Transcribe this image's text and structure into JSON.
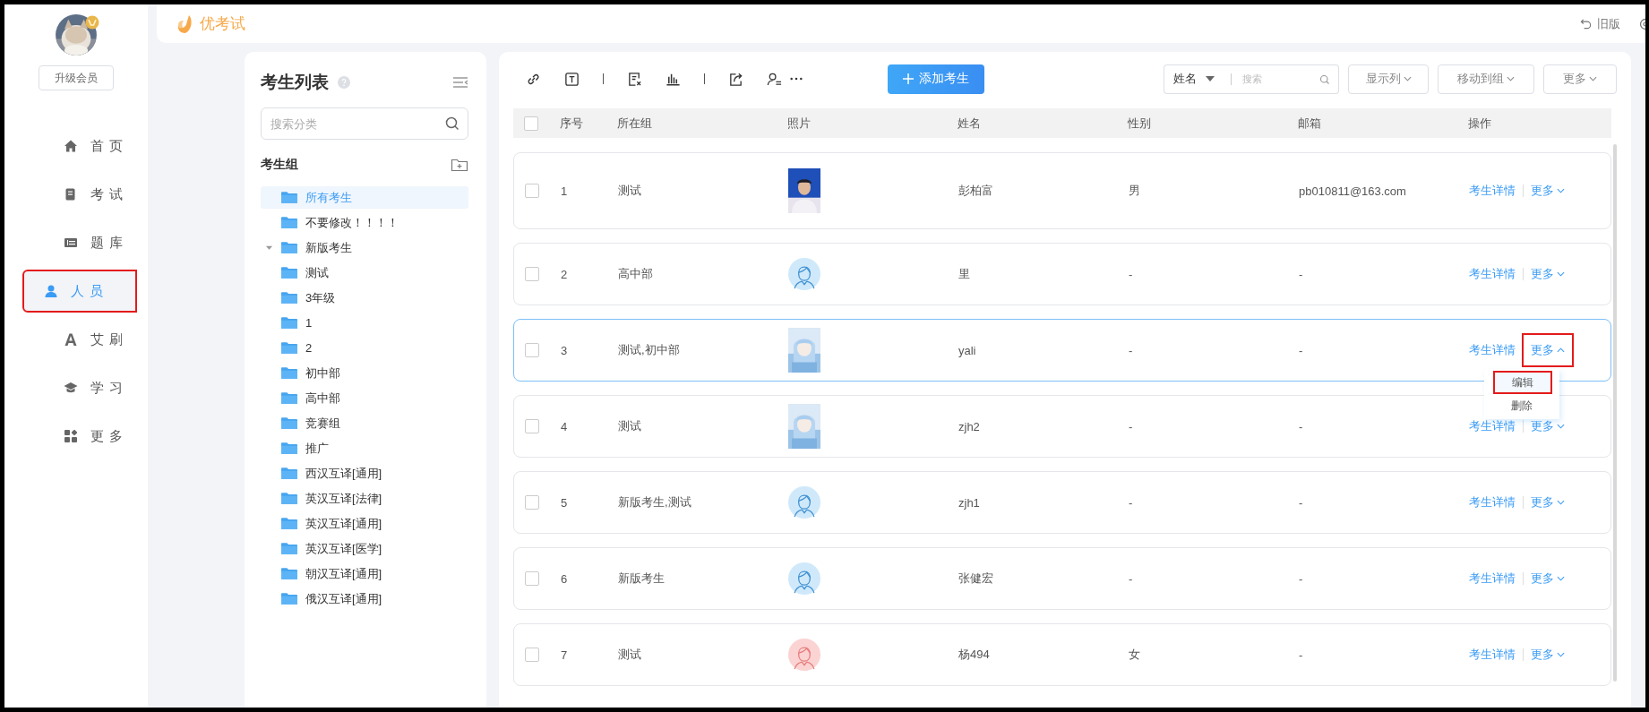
{
  "sidebar": {
    "avatar": {
      "kind": "picture"
    },
    "upgrade_button": "升级会员",
    "items": [
      {
        "kind": "home",
        "label": "首页",
        "selected": false,
        "annotated": false
      },
      {
        "kind": "exam",
        "label": "考试",
        "selected": false,
        "annotated": false
      },
      {
        "kind": "bank",
        "label": "题库",
        "selected": false,
        "annotated": false
      },
      {
        "kind": "people",
        "label": "人员",
        "selected": true,
        "annotated": true
      },
      {
        "kind": "print",
        "label": "艾刷",
        "selected": false,
        "annotated": false
      },
      {
        "kind": "study",
        "label": "学习",
        "selected": false,
        "annotated": false
      },
      {
        "kind": "more",
        "label": "更多",
        "selected": false,
        "annotated": false
      }
    ]
  },
  "header": {
    "logo": "优考试",
    "old_version": "旧版"
  },
  "groups": {
    "title": "考生列表",
    "search": {
      "placeholder": "搜索分类"
    },
    "section": "考生组",
    "items": [
      {
        "label": "所有考生",
        "selected": true
      },
      {
        "label": "不要修改！！！！",
        "selected": false
      },
      {
        "label": "新版考生",
        "selected": false,
        "expanded": true
      },
      {
        "label": "测试",
        "selected": false
      },
      {
        "label": "3年级",
        "selected": false
      },
      {
        "label": "1",
        "selected": false
      },
      {
        "label": "2",
        "selected": false
      },
      {
        "label": "初中部",
        "selected": false
      },
      {
        "label": "高中部",
        "selected": false
      },
      {
        "label": "竞赛组",
        "selected": false
      },
      {
        "label": "推广",
        "selected": false
      },
      {
        "label": "西汉互译[通用]",
        "selected": false
      },
      {
        "label": "英汉互译[法律]",
        "selected": false
      },
      {
        "label": "英汉互译[通用]",
        "selected": false
      },
      {
        "label": "英汉互译[医学]",
        "selected": false
      },
      {
        "label": "朝汉互译[通用]",
        "selected": false
      },
      {
        "label": "俄汉互译[通用]",
        "selected": false
      }
    ]
  },
  "toolbar": {
    "add_button": "添加考生",
    "search_field": {
      "field": "姓名",
      "placeholder": "搜索"
    },
    "buttons": [
      "显示列",
      "移动到组",
      "更多"
    ]
  },
  "table": {
    "all_checked": false,
    "columns": [
      "序号",
      "所在组",
      "照片",
      "姓名",
      "性别",
      "邮箱",
      "操作"
    ],
    "rows": [
      {
        "index": "1",
        "group": "测试",
        "photo": {
          "kind": "picture"
        },
        "name": "彭柏富",
        "gender": "男",
        "email": "pb010811@163.com",
        "detail": "考生详情",
        "more": "更多",
        "checked": false,
        "selected": false,
        "menu_open": false
      },
      {
        "index": "2",
        "group": "高中部",
        "photo": {
          "kind": "default",
          "color": "#cfe9fb"
        },
        "name": "里",
        "gender": "-",
        "email": "-",
        "detail": "考生详情",
        "more": "更多",
        "checked": false,
        "selected": false,
        "menu_open": false
      },
      {
        "index": "3",
        "group": "测试,初中部",
        "photo": {
          "kind": "picture"
        },
        "name": "yali",
        "gender": "-",
        "email": "-",
        "detail": "考生详情",
        "more": "更多",
        "checked": false,
        "selected": true,
        "menu_open": true,
        "menu": [
          {
            "label": "编辑",
            "hovered": true,
            "annotated": true
          },
          {
            "label": "删除",
            "hovered": false,
            "annotated": false
          }
        ]
      },
      {
        "index": "4",
        "group": "测试",
        "photo": {
          "kind": "picture"
        },
        "name": "zjh2",
        "gender": "-",
        "email": "-",
        "detail": "考生详情",
        "more": "更多",
        "checked": false,
        "selected": false,
        "menu_open": false
      },
      {
        "index": "5",
        "group": "新版考生,测试",
        "photo": {
          "kind": "default",
          "color": "#cfe9fb"
        },
        "name": "zjh1",
        "gender": "-",
        "email": "-",
        "detail": "考生详情",
        "more": "更多",
        "checked": false,
        "selected": false,
        "menu_open": false
      },
      {
        "index": "6",
        "group": "新版考生",
        "photo": {
          "kind": "default",
          "color": "#cfe9fb"
        },
        "name": "张健宏",
        "gender": "-",
        "email": "-",
        "detail": "考生详情",
        "more": "更多",
        "checked": false,
        "selected": false,
        "menu_open": false
      },
      {
        "index": "7",
        "group": "测试",
        "photo": {
          "kind": "default",
          "color": "#fbd3d3"
        },
        "name": "杨494",
        "gender": "女",
        "email": "-",
        "detail": "考生详情",
        "more": "更多",
        "checked": false,
        "selected": false,
        "menu_open": false
      }
    ]
  }
}
